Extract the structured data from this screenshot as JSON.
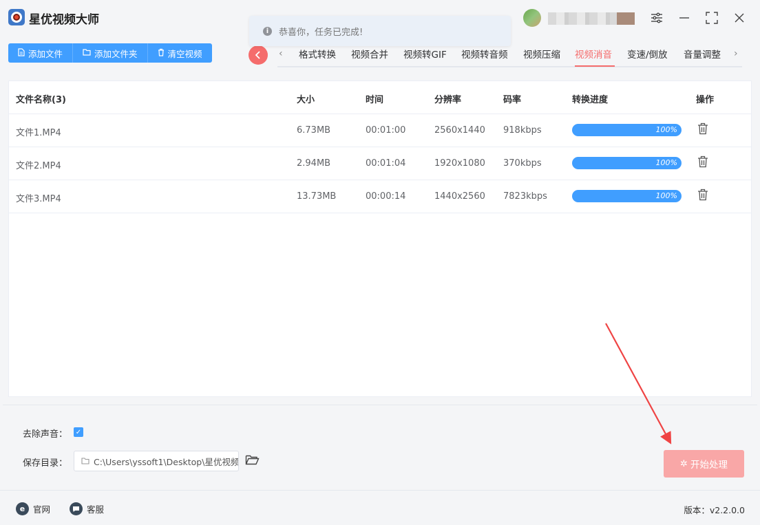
{
  "app": {
    "title": "星优视频大师"
  },
  "toast": {
    "text": "恭喜你，任务已完成!"
  },
  "toolbar": {
    "add_file": "添加文件",
    "add_folder": "添加文件夹",
    "clear": "清空视频"
  },
  "tabs": [
    {
      "label": "格式转换",
      "active": false
    },
    {
      "label": "视频合并",
      "active": false
    },
    {
      "label": "视频转GIF",
      "active": false
    },
    {
      "label": "视频转音频",
      "active": false
    },
    {
      "label": "视频压缩",
      "active": false
    },
    {
      "label": "视频消音",
      "active": true
    },
    {
      "label": "变速/倒放",
      "active": false
    },
    {
      "label": "音量调整",
      "active": false
    }
  ],
  "table": {
    "headers": {
      "name": "文件名称(3)",
      "size": "大小",
      "duration": "时间",
      "resolution": "分辨率",
      "bitrate": "码率",
      "progress": "转换进度",
      "action": "操作"
    },
    "rows": [
      {
        "name": "文件1.MP4",
        "size": "6.73MB",
        "duration": "00:01:00",
        "resolution": "2560x1440",
        "bitrate": "918kbps",
        "progress_label": "100%",
        "progress": 100
      },
      {
        "name": "文件2.MP4",
        "size": "2.94MB",
        "duration": "00:01:04",
        "resolution": "1920x1080",
        "bitrate": "370kbps",
        "progress_label": "100%",
        "progress": 100
      },
      {
        "name": "文件3.MP4",
        "size": "13.73MB",
        "duration": "00:00:14",
        "resolution": "1440x2560",
        "bitrate": "7823kbps",
        "progress_label": "100%",
        "progress": 100
      }
    ]
  },
  "options": {
    "remove_audio_label": "去除声音：",
    "remove_audio_checked": true,
    "save_dir_label": "保存目录：",
    "save_dir_value": "C:\\Users\\yssoft1\\Desktop\\星优视频"
  },
  "start_button": "开始处理",
  "footer": {
    "website": "官网",
    "support": "客服",
    "version": "版本：v2.2.0.0"
  },
  "colors": {
    "primary": "#409eff",
    "danger": "#f56c6c",
    "start_disabled": "#f9a7a7"
  },
  "icons": {
    "logo": "app-logo-icon",
    "settings": "settings-sliders-icon",
    "minimize": "minimize-icon",
    "maximize": "maximize-icon",
    "close": "close-icon",
    "delete": "trash-icon",
    "folder": "folder-icon"
  }
}
